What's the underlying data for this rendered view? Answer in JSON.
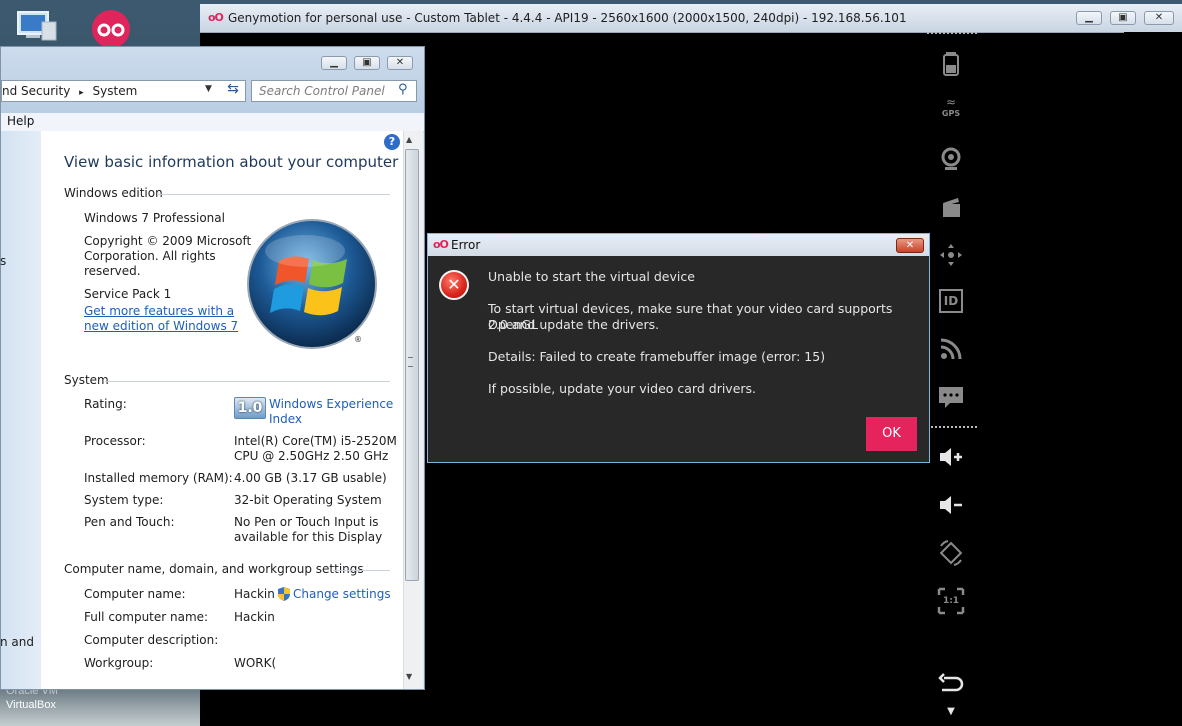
{
  "desktop": {
    "icon_virtualbox_line1": "Oracle VM",
    "icon_virtualbox_line2": "VirtualBox",
    "left_edge_text1": "s",
    "left_edge_text2": "n and"
  },
  "genymotion": {
    "title": "Genymotion for personal use - Custom Tablet - 4.4.4 - API19 - 2560x1600 (2000x1500, 240dpi) - 192.168.56.101",
    "logo": "oO",
    "sidebar_icons": [
      "battery-icon",
      "gps-icon",
      "camera-icon",
      "capture-icon",
      "dpad-icon",
      "id-icon",
      "rss-icon",
      "sms-icon",
      "volume-up-icon",
      "volume-down-icon",
      "rotate-icon",
      "scale-icon",
      "back-icon",
      "menu-icon"
    ],
    "gps_label": "GPS",
    "id_label": "ID",
    "scale_label": "1:1"
  },
  "control_panel": {
    "breadcrumb_part1": "nd Security",
    "breadcrumb_sep": "▸",
    "breadcrumb_part2": "System",
    "search_placeholder": "Search Control Panel",
    "menu_help": "Help",
    "heading": "View basic information about your computer",
    "windows_edition": {
      "section_title": "Windows edition",
      "edition": "Windows 7 Professional",
      "copyright_l1": "Copyright © 2009 Microsoft",
      "copyright_l2": "Corporation.  All rights",
      "copyright_l3": "reserved.",
      "service_pack": "Service Pack 1",
      "upgrade_link_l1": "Get more features with a",
      "upgrade_link_l2": "new edition of Windows 7"
    },
    "system": {
      "section_title": "System",
      "rating_label": "Rating:",
      "rating_score": "1.0",
      "rating_link_l1": "Windows Experience",
      "rating_link_l2": "Index",
      "processor_label": "Processor:",
      "processor_l1": "Intel(R) Core(TM) i5-2520M",
      "processor_l2": "CPU @ 2.50GHz   2.50 GHz",
      "memory_label": "Installed memory (RAM):",
      "memory_value": "4.00 GB (3.17 GB usable)",
      "type_label": "System type:",
      "type_value": "32-bit Operating System",
      "pen_label": "Pen and Touch:",
      "pen_l1": "No Pen or Touch Input is",
      "pen_l2": "available for this Display"
    },
    "computer": {
      "section_title": "Computer name, domain, and workgroup settings",
      "name_label": "Computer name:",
      "name_value": "Hackin",
      "change_settings": "Change settings",
      "full_label": "Full computer name:",
      "full_value": "Hackin",
      "desc_label": "Computer description:",
      "workgroup_label": "Workgroup:",
      "workgroup_value": "WORK("
    }
  },
  "error_dialog": {
    "title": "Error",
    "close": "✕",
    "line1": "Unable to start the virtual device",
    "line2a": "To start virtual devices, make sure that your video card supports OpenGL",
    "line2b": "2.0 and update the drivers.",
    "line3": "Details: Failed to create framebuffer image (error: 15)",
    "line4": "If possible, update your video card drivers.",
    "ok": "OK"
  }
}
